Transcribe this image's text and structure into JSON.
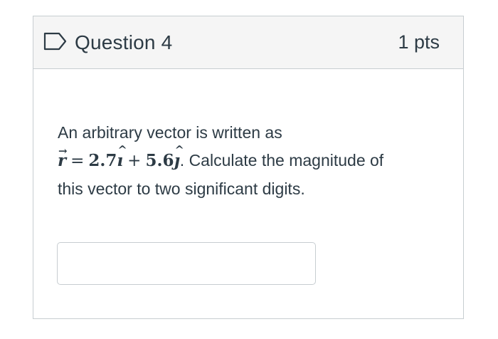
{
  "question": {
    "title": "Question 4",
    "points": "1 pts",
    "text_line1": "An arbitrary vector is written as",
    "equation": {
      "vector_var": "r",
      "equals": "=",
      "coef_i": "2.7",
      "unit_i": "ı",
      "plus": "+",
      "coef_j": "5.6",
      "unit_j": "ȷ"
    },
    "text_after_equation": ". Calculate the magnitude of",
    "text_line3": "this vector to two significant digits.",
    "answer_value": ""
  },
  "icons": {
    "flag": "flag-outline-icon"
  },
  "colors": {
    "header_background": "#f5f5f5",
    "border": "#c7cdd1",
    "text": "#2d3b45",
    "flag_icon": "#2d3b45"
  }
}
